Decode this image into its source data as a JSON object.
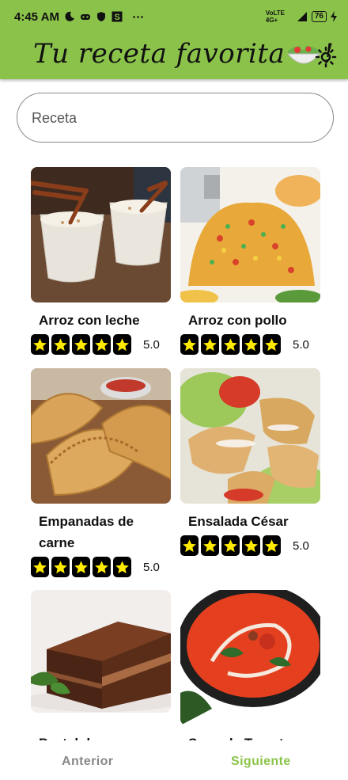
{
  "status_bar": {
    "time": "4:45 AM",
    "network": "VoLTE 4G+",
    "battery": "76"
  },
  "app_bar": {
    "title_part1": "Tu receta favorita",
    "title_part2": "!",
    "icon": "salad-bowl-icon",
    "theme_icon": "sun-icon"
  },
  "search": {
    "placeholder": "Receta",
    "value": ""
  },
  "colors": {
    "accent": "#8bc34a",
    "star": "#ffeb00"
  },
  "recipes": [
    {
      "name": "Arroz con leche",
      "rating": "5.0",
      "stars": 5
    },
    {
      "name": "Arroz con pollo",
      "rating": "5.0",
      "stars": 5
    },
    {
      "name": "Empanadas de carne",
      "rating": "5.0",
      "stars": 5
    },
    {
      "name": "Ensalada César",
      "rating": "5.0",
      "stars": 5
    },
    {
      "name": "Pastel de",
      "rating": "",
      "stars": 0
    },
    {
      "name": "Sopa de Tomate",
      "rating": "",
      "stars": 0
    }
  ],
  "nav": {
    "prev_label": "Anterior",
    "next_label": "Siguiente"
  }
}
